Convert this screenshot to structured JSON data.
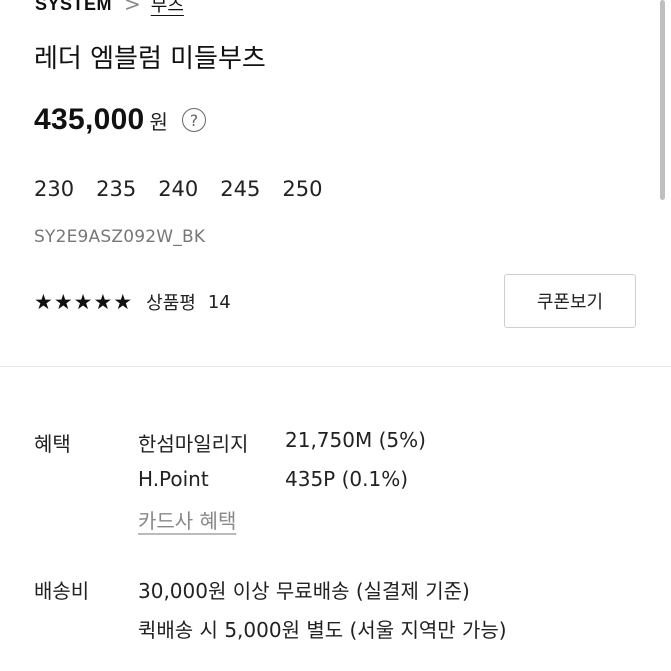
{
  "breadcrumb": {
    "brand": "SYSTEM",
    "separator": ">",
    "category": "부츠"
  },
  "product": {
    "title": "레더 엠블럼 미들부츠",
    "price": "435,000",
    "currency": "원",
    "help_symbol": "?",
    "sizes": [
      "230",
      "235",
      "240",
      "245",
      "250"
    ],
    "code": "SY2E9ASZ092W_BK"
  },
  "rating": {
    "stars": 5,
    "label": "상품평",
    "count": "14"
  },
  "coupon": {
    "label": "쿠폰보기"
  },
  "benefits": {
    "label": "혜택",
    "items": [
      {
        "name": "한섬마일리지",
        "value": "21,750M (5%)"
      },
      {
        "name": "H.Point",
        "value": "435P (0.1%)"
      }
    ],
    "card_link": "카드사 혜택"
  },
  "shipping": {
    "label": "배송비",
    "lines": [
      "30,000원 이상 무료배송 (실결제 기준)",
      "퀵배송 시 5,000원 별도 (서울 지역만 가능)"
    ]
  },
  "icons": {
    "help": "question-circle-icon",
    "chevron": "chevron-right-icon",
    "star": "star-icon"
  }
}
